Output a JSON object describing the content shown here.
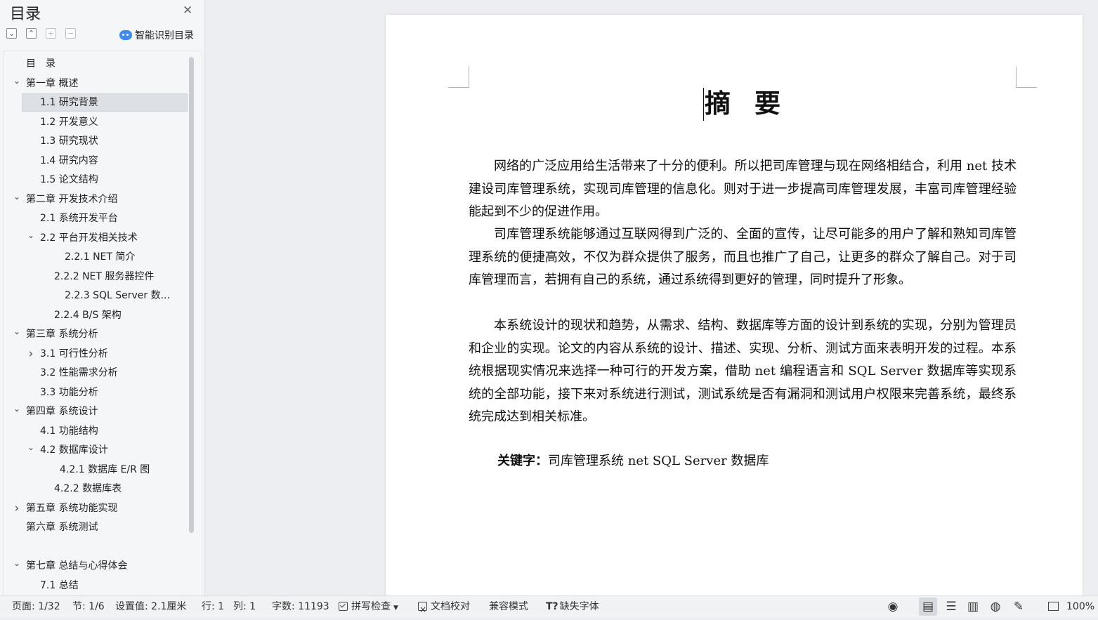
{
  "sidebar": {
    "title": "目录",
    "close_icon": "close-icon",
    "tools": [
      "collapse-all-icon",
      "expand-all-icon",
      "promote-icon",
      "demote-icon"
    ],
    "smart_label": "智能识别目录",
    "accent": "#3d8bf0",
    "toc": [
      {
        "label": "目　录",
        "level": 0,
        "chevron": ""
      },
      {
        "label": "第一章  概述",
        "level": 0,
        "chevron": "v"
      },
      {
        "label": "1.1  研究背景",
        "level": 1,
        "chevron": "",
        "selected": true
      },
      {
        "label": "1.2  开发意义",
        "level": 1,
        "chevron": ""
      },
      {
        "label": "1.3  研究现状",
        "level": 1,
        "chevron": ""
      },
      {
        "label": "1.4  研究内容",
        "level": 1,
        "chevron": ""
      },
      {
        "label": "1.5  论文结构",
        "level": 1,
        "chevron": ""
      },
      {
        "label": " 第二章  开发技术介绍",
        "level": 0,
        "chevron": "v"
      },
      {
        "label": "2.1  系统开发平台",
        "level": 1,
        "chevron": ""
      },
      {
        "label": "2.2  平台开发相关技术",
        "level": 1,
        "chevron": "v"
      },
      {
        "label": "2.2.1    NET 简介",
        "level": 3,
        "chevron": ""
      },
      {
        "label": "2.2.2    NET 服务器控件",
        "level": 2,
        "chevron": ""
      },
      {
        "label": "2.2.3    SQL Server 数...",
        "level": 3,
        "chevron": ""
      },
      {
        "label": "2.2.4    B/S 架构",
        "level": 2,
        "chevron": ""
      },
      {
        "label": "第三章  系统分析",
        "level": 0,
        "chevron": "v"
      },
      {
        "label": "3.1  可行性分析",
        "level": 1,
        "chevron": ">"
      },
      {
        "label": "3.2 性能需求分析",
        "level": 1,
        "chevron": ""
      },
      {
        "label": "3.3 功能分析",
        "level": 1,
        "chevron": ""
      },
      {
        "label": "第四章  系统设计",
        "level": 0,
        "chevron": "v"
      },
      {
        "label": "4.1 功能结构",
        "level": 1,
        "chevron": ""
      },
      {
        "label": "4.2  数据库设计",
        "level": 1,
        "chevron": "v"
      },
      {
        "label": "4.2.1  数据库 E/R 图",
        "level": 4,
        "chevron": ""
      },
      {
        "label": "4.2.2  数据库表",
        "level": 2,
        "chevron": ""
      },
      {
        "label": "第五章  系统功能实现",
        "level": 0,
        "chevron": ">"
      },
      {
        "label": "第六章  系统测试",
        "level": 0,
        "chevron": ""
      },
      {
        "label": "",
        "level": 0,
        "chevron": ""
      },
      {
        "label": "第七章  总结与心得体会",
        "level": 0,
        "chevron": "v"
      },
      {
        "label": "7.1  总结",
        "level": 1,
        "chevron": ""
      }
    ]
  },
  "document": {
    "title": "摘要",
    "paragraphs": [
      "网络的广泛应用给生活带来了十分的便利。所以把司库管理与现在网络相结合，利用 net 技术建设司库管理系统，实现司库管理的信息化。则对于进一步提高司库管理发展，丰富司库管理经验能起到不少的促进作用。",
      "司库管理系统能够通过互联网得到广泛的、全面的宣传，让尽可能多的用户了解和熟知司库管理系统的便捷高效，不仅为群众提供了服务，而且也推广了自己，让更多的群众了解自己。对于司库管理而言，若拥有自己的系统，通过系统得到更好的管理，同时提升了形象。",
      "本系统设计的现状和趋势，从需求、结构、数据库等方面的设计到系统的实现，分别为管理员和企业的实现。论文的内容从系统的设计、描述、实现、分析、测试方面来表明开发的过程。本系统根据现实情况来选择一种可行的开发方案，借助 net 编程语言和 SQL Server 数据库等实现系统的全部功能，接下来对系统进行测试，测试系统是否有漏洞和测试用户权限来完善系统，最终系统完成达到相关标准。"
    ],
    "keywords_label": "关键字：",
    "keywords_value": "司库管理系统 net  SQL Server 数据库"
  },
  "status": {
    "page": "页面: 1/32",
    "section": "节: 1/6",
    "setting": "设置值: 2.1厘米",
    "row": "行: 1",
    "col": "列: 1",
    "words": "字数: 11193",
    "spell": "拼写检查",
    "proof": "文档校对",
    "compat": "兼容模式",
    "missing_font": "缺失字体",
    "zoom": "100%",
    "view_icons": [
      "eye-protection-icon",
      "page-view-icon",
      "outline-view-icon",
      "reading-view-icon",
      "web-view-icon",
      "pen-icon"
    ]
  }
}
